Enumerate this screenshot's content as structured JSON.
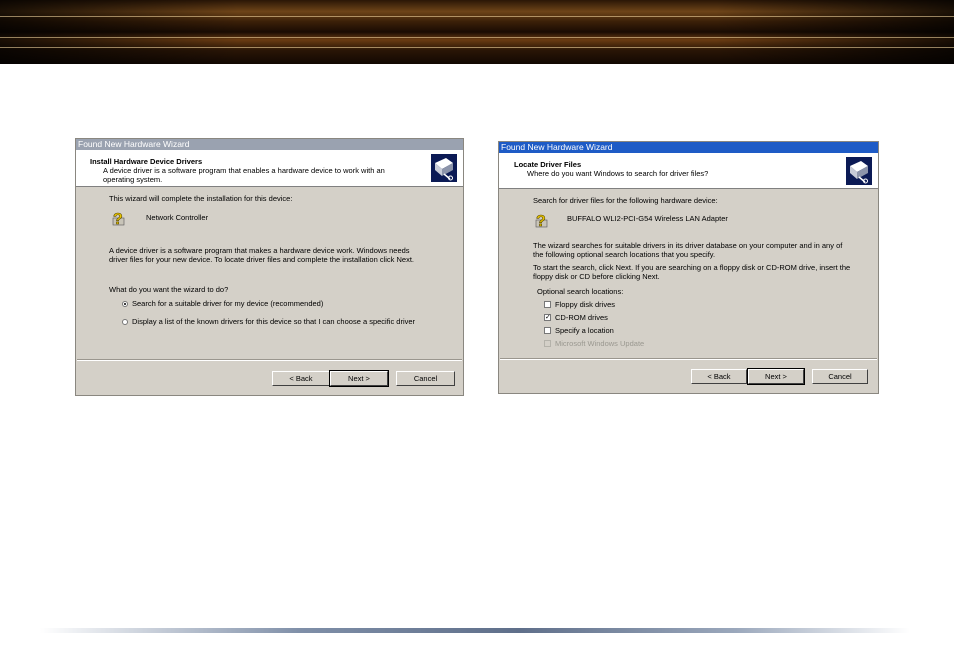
{
  "left_wizard": {
    "title_bar": "Found New Hardware Wizard",
    "header_title": "Install Hardware Device Drivers",
    "header_subtitle_1": "A device driver is a software program that enables a hardware device to work with an",
    "header_subtitle_2": "operating system.",
    "intro": "This wizard will complete the installation for this device:",
    "device_name": "Network Controller",
    "description_1": "A device driver is a software program that makes a hardware device work. Windows needs",
    "description_2": "driver files for your new device. To locate driver files and complete the installation click Next.",
    "question": "What do you want the wizard to do?",
    "option_search": "Search for a suitable driver for my device (recommended)",
    "option_display": "Display a list of the known drivers for this device so that I can choose a specific driver",
    "back_label": "< Back",
    "next_label": "Next >",
    "cancel_label": "Cancel"
  },
  "right_wizard": {
    "title_bar": "Found New Hardware Wizard",
    "header_title": "Locate Driver Files",
    "header_subtitle": "Where do you want Windows to search for driver files?",
    "intro": "Search for driver files for the following hardware device:",
    "device_name": "BUFFALO WLI2-PCI-G54 Wireless LAN Adapter",
    "description_1": "The wizard searches for suitable drivers in its driver database on your computer and in any of",
    "description_2": "the following optional search locations that you specify.",
    "instructions_1": "To start the search, click Next. If you are searching on a floppy disk or CD-ROM drive, insert the",
    "instructions_2": "floppy disk or CD before clicking Next.",
    "locations_heading": "Optional search locations:",
    "loc_floppy": "Floppy disk drives",
    "loc_cdrom": "CD-ROM drives",
    "loc_specify": "Specify a location",
    "loc_windows_update": "Microsoft Windows Update",
    "back_label": "< Back",
    "next_label": "Next >",
    "cancel_label": "Cancel"
  },
  "state": {
    "left_selected_option": "search",
    "right_checked": [
      "cdrom"
    ],
    "right_disabled": [
      "windows_update"
    ]
  },
  "colors": {
    "dialog_face": "#d4d0c8",
    "title_inactive": "#9aa2b0",
    "title_active": "#1e5bc6",
    "banner_brown": "#6e4418"
  },
  "icons": {
    "wizard_header": "hardware-wizard-icon",
    "device": "unknown-device-question-icon"
  }
}
